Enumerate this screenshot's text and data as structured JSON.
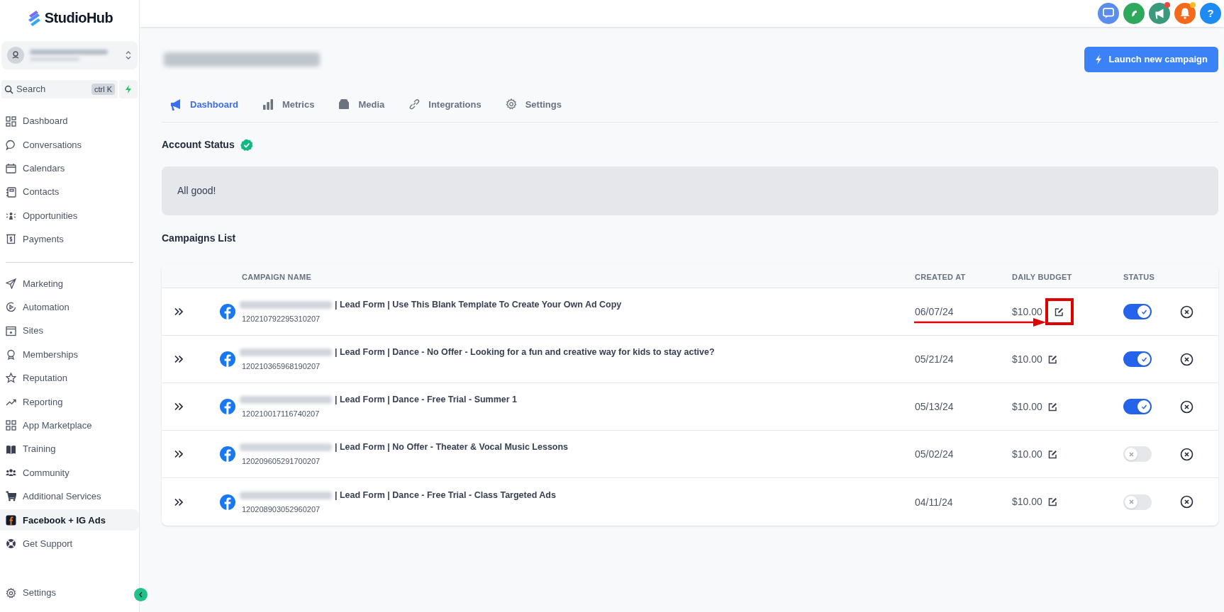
{
  "brand": {
    "name": "StudioHub"
  },
  "sidebar": {
    "search": {
      "placeholder": "Search",
      "shortcut": "ctrl K"
    },
    "sections": [
      {
        "items": [
          {
            "label": "Dashboard",
            "selected": false
          },
          {
            "label": "Conversations",
            "selected": false
          },
          {
            "label": "Calendars",
            "selected": false
          },
          {
            "label": "Contacts",
            "selected": false
          },
          {
            "label": "Opportunities",
            "selected": false
          },
          {
            "label": "Payments",
            "selected": false
          }
        ]
      },
      {
        "items": [
          {
            "label": "Marketing",
            "selected": false
          },
          {
            "label": "Automation",
            "selected": false
          },
          {
            "label": "Sites",
            "selected": false
          },
          {
            "label": "Memberships",
            "selected": false
          },
          {
            "label": "Reputation",
            "selected": false
          },
          {
            "label": "Reporting",
            "selected": false
          },
          {
            "label": "App Marketplace",
            "selected": false
          },
          {
            "label": "Training",
            "selected": false
          },
          {
            "label": "Community",
            "selected": false
          },
          {
            "label": "Additional Services",
            "selected": false
          },
          {
            "label": "Facebook + IG Ads",
            "selected": true
          },
          {
            "label": "Get Support",
            "selected": false
          }
        ]
      }
    ],
    "footer_item": {
      "label": "Settings"
    }
  },
  "topbar_icons": [
    {
      "kind": "chat",
      "color": "#5b8def",
      "badge": false
    },
    {
      "kind": "phone",
      "color": "#2ea85a",
      "badge": false
    },
    {
      "kind": "megaphone",
      "color": "#3c9a7c",
      "badge": true
    },
    {
      "kind": "bell",
      "color": "#f26b1d",
      "badge": true
    },
    {
      "kind": "help",
      "color": "#1d8bf1",
      "badge": false,
      "label": "?"
    }
  ],
  "launch_button": {
    "label": "Launch new campaign"
  },
  "tabs": [
    {
      "label": "Dashboard",
      "selected": true
    },
    {
      "label": "Metrics",
      "selected": false
    },
    {
      "label": "Media",
      "selected": false
    },
    {
      "label": "Integrations",
      "selected": false
    },
    {
      "label": "Settings",
      "selected": false
    }
  ],
  "account_status": {
    "title": "Account Status",
    "ok": true,
    "message": "All good!"
  },
  "campaigns": {
    "title": "Campaigns List",
    "columns": [
      "CAMPAIGN NAME",
      "CREATED AT",
      "DAILY BUDGET",
      "STATUS"
    ],
    "rows": [
      {
        "name": "| Lead Form | Use This Blank Template To Create Your Own Ad Copy",
        "id": "120210792295310207",
        "created_at": "06/07/24",
        "budget": "$10.00",
        "on": true,
        "highlighted": true
      },
      {
        "name": "| Lead Form | Dance - No Offer - Looking for a fun and creative way for kids to stay active?",
        "id": "120210365968190207",
        "created_at": "05/21/24",
        "budget": "$10.00",
        "on": true,
        "highlighted": false
      },
      {
        "name": "| Lead Form | Dance - Free Trial - Summer 1",
        "id": "120210017116740207",
        "created_at": "05/13/24",
        "budget": "$10.00",
        "on": true,
        "highlighted": false
      },
      {
        "name": "| Lead Form | No Offer - Theater & Vocal Music Lessons",
        "id": "120209605291700207",
        "created_at": "05/02/24",
        "budget": "$10.00",
        "on": false,
        "highlighted": false
      },
      {
        "name": "| Lead Form | Dance - Free Trial - Class Targeted Ads",
        "id": "120208903052960207",
        "created_at": "04/11/24",
        "budget": "$10.00",
        "on": false,
        "highlighted": false
      }
    ]
  }
}
